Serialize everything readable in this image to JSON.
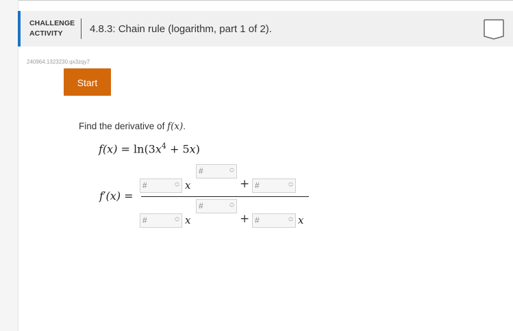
{
  "header": {
    "caption_line1": "CHALLENGE",
    "caption_line2": "ACTIVITY",
    "title": "4.8.3: Chain rule (logarithm, part 1 of 2)."
  },
  "activity_id": "240964.1323230.qx3zqy7",
  "start_label": "Start",
  "problem": {
    "prompt": "Find the derivative of ",
    "prompt_fx": "f(x)",
    "prompt_end": ".",
    "function_lhs": "f(x)",
    "function_eq": " = ",
    "function_ln": "ln",
    "function_arg_open": "(3",
    "function_x1": "x",
    "function_exp": "4",
    "function_plus": " + 5",
    "function_x2": "x",
    "function_close": ")",
    "derivative_lhs": "f′(x)",
    "derivative_eq": " ="
  },
  "inputs": {
    "placeholder": "#",
    "variable": "x",
    "plus": "+"
  },
  "colors": {
    "accent": "#1a73c7",
    "start_button": "#d3680a"
  }
}
